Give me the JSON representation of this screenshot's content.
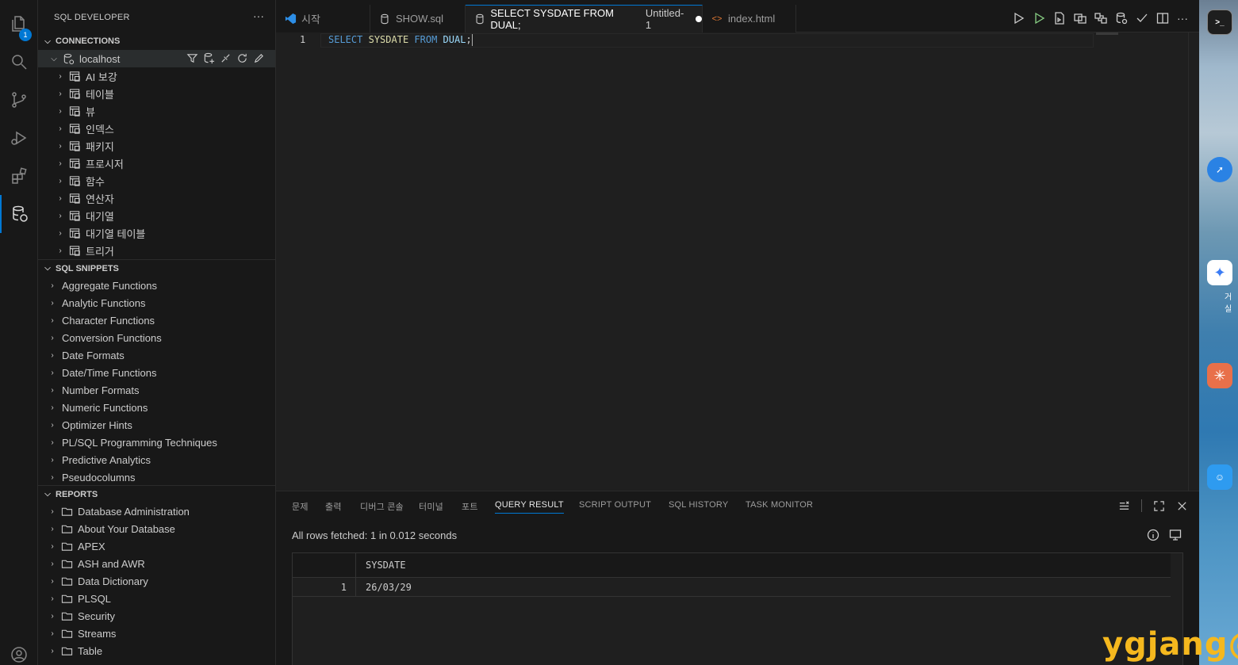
{
  "sidebar": {
    "title": "SQL DEVELOPER",
    "more": "···",
    "connections": {
      "header": "CONNECTIONS",
      "host": "localhost",
      "items": [
        "AI 보강",
        "테이블",
        "뷰",
        "인덱스",
        "패키지",
        "프로시저",
        "함수",
        "연산자",
        "대기열",
        "대기열 테이블",
        "트리거"
      ]
    },
    "snippets": {
      "header": "SQL SNIPPETS",
      "items": [
        "Aggregate Functions",
        "Analytic Functions",
        "Character Functions",
        "Conversion Functions",
        "Date Formats",
        "Date/Time Functions",
        "Number Formats",
        "Numeric Functions",
        "Optimizer Hints",
        "PL/SQL Programming Techniques",
        "Predictive Analytics",
        "Pseudocolumns"
      ]
    },
    "reports": {
      "header": "REPORTS",
      "items": [
        "Database Administration",
        "About Your Database",
        "APEX",
        "ASH and AWR",
        "Data Dictionary",
        "PLSQL",
        "Security",
        "Streams",
        "Table"
      ]
    }
  },
  "activity": {
    "badge": "1"
  },
  "tabs": {
    "t1": "시작",
    "t2": "SHOW.sql",
    "t3": "SELECT SYSDATE FROM DUAL;",
    "t3_suffix": "Untitled-1",
    "t4": "index.html"
  },
  "editor": {
    "line_number": "1",
    "tok_select": "SELECT",
    "tok_sysdate": "SYSDATE",
    "tok_from": "FROM",
    "tok_dual": "DUAL",
    "tok_semi": ";"
  },
  "panel": {
    "tabs": [
      "문제",
      "출력",
      "디버그 콘솔",
      "터미널",
      "포트",
      "QUERY RESULT",
      "SCRIPT OUTPUT",
      "SQL HISTORY",
      "TASK MONITOR"
    ],
    "status": "All rows fetched: 1 in 0.012 seconds",
    "column": "SYSDATE",
    "row_num": "1",
    "row_value": "26/03/29"
  },
  "desktop": {
    "label": "거실"
  },
  "watermark": "ygjang@"
}
